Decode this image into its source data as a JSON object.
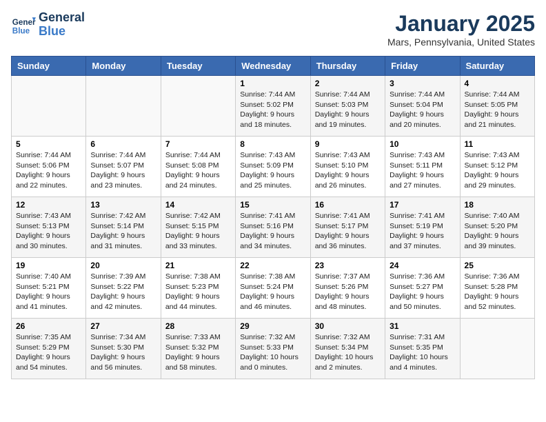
{
  "header": {
    "logo_line1": "General",
    "logo_line2": "Blue",
    "title": "January 2025",
    "subtitle": "Mars, Pennsylvania, United States"
  },
  "weekdays": [
    "Sunday",
    "Monday",
    "Tuesday",
    "Wednesday",
    "Thursday",
    "Friday",
    "Saturday"
  ],
  "weeks": [
    [
      {
        "day": "",
        "sunrise": "",
        "sunset": "",
        "daylight": ""
      },
      {
        "day": "",
        "sunrise": "",
        "sunset": "",
        "daylight": ""
      },
      {
        "day": "",
        "sunrise": "",
        "sunset": "",
        "daylight": ""
      },
      {
        "day": "1",
        "sunrise": "Sunrise: 7:44 AM",
        "sunset": "Sunset: 5:02 PM",
        "daylight": "Daylight: 9 hours and 18 minutes."
      },
      {
        "day": "2",
        "sunrise": "Sunrise: 7:44 AM",
        "sunset": "Sunset: 5:03 PM",
        "daylight": "Daylight: 9 hours and 19 minutes."
      },
      {
        "day": "3",
        "sunrise": "Sunrise: 7:44 AM",
        "sunset": "Sunset: 5:04 PM",
        "daylight": "Daylight: 9 hours and 20 minutes."
      },
      {
        "day": "4",
        "sunrise": "Sunrise: 7:44 AM",
        "sunset": "Sunset: 5:05 PM",
        "daylight": "Daylight: 9 hours and 21 minutes."
      }
    ],
    [
      {
        "day": "5",
        "sunrise": "Sunrise: 7:44 AM",
        "sunset": "Sunset: 5:06 PM",
        "daylight": "Daylight: 9 hours and 22 minutes."
      },
      {
        "day": "6",
        "sunrise": "Sunrise: 7:44 AM",
        "sunset": "Sunset: 5:07 PM",
        "daylight": "Daylight: 9 hours and 23 minutes."
      },
      {
        "day": "7",
        "sunrise": "Sunrise: 7:44 AM",
        "sunset": "Sunset: 5:08 PM",
        "daylight": "Daylight: 9 hours and 24 minutes."
      },
      {
        "day": "8",
        "sunrise": "Sunrise: 7:43 AM",
        "sunset": "Sunset: 5:09 PM",
        "daylight": "Daylight: 9 hours and 25 minutes."
      },
      {
        "day": "9",
        "sunrise": "Sunrise: 7:43 AM",
        "sunset": "Sunset: 5:10 PM",
        "daylight": "Daylight: 9 hours and 26 minutes."
      },
      {
        "day": "10",
        "sunrise": "Sunrise: 7:43 AM",
        "sunset": "Sunset: 5:11 PM",
        "daylight": "Daylight: 9 hours and 27 minutes."
      },
      {
        "day": "11",
        "sunrise": "Sunrise: 7:43 AM",
        "sunset": "Sunset: 5:12 PM",
        "daylight": "Daylight: 9 hours and 29 minutes."
      }
    ],
    [
      {
        "day": "12",
        "sunrise": "Sunrise: 7:43 AM",
        "sunset": "Sunset: 5:13 PM",
        "daylight": "Daylight: 9 hours and 30 minutes."
      },
      {
        "day": "13",
        "sunrise": "Sunrise: 7:42 AM",
        "sunset": "Sunset: 5:14 PM",
        "daylight": "Daylight: 9 hours and 31 minutes."
      },
      {
        "day": "14",
        "sunrise": "Sunrise: 7:42 AM",
        "sunset": "Sunset: 5:15 PM",
        "daylight": "Daylight: 9 hours and 33 minutes."
      },
      {
        "day": "15",
        "sunrise": "Sunrise: 7:41 AM",
        "sunset": "Sunset: 5:16 PM",
        "daylight": "Daylight: 9 hours and 34 minutes."
      },
      {
        "day": "16",
        "sunrise": "Sunrise: 7:41 AM",
        "sunset": "Sunset: 5:17 PM",
        "daylight": "Daylight: 9 hours and 36 minutes."
      },
      {
        "day": "17",
        "sunrise": "Sunrise: 7:41 AM",
        "sunset": "Sunset: 5:19 PM",
        "daylight": "Daylight: 9 hours and 37 minutes."
      },
      {
        "day": "18",
        "sunrise": "Sunrise: 7:40 AM",
        "sunset": "Sunset: 5:20 PM",
        "daylight": "Daylight: 9 hours and 39 minutes."
      }
    ],
    [
      {
        "day": "19",
        "sunrise": "Sunrise: 7:40 AM",
        "sunset": "Sunset: 5:21 PM",
        "daylight": "Daylight: 9 hours and 41 minutes."
      },
      {
        "day": "20",
        "sunrise": "Sunrise: 7:39 AM",
        "sunset": "Sunset: 5:22 PM",
        "daylight": "Daylight: 9 hours and 42 minutes."
      },
      {
        "day": "21",
        "sunrise": "Sunrise: 7:38 AM",
        "sunset": "Sunset: 5:23 PM",
        "daylight": "Daylight: 9 hours and 44 minutes."
      },
      {
        "day": "22",
        "sunrise": "Sunrise: 7:38 AM",
        "sunset": "Sunset: 5:24 PM",
        "daylight": "Daylight: 9 hours and 46 minutes."
      },
      {
        "day": "23",
        "sunrise": "Sunrise: 7:37 AM",
        "sunset": "Sunset: 5:26 PM",
        "daylight": "Daylight: 9 hours and 48 minutes."
      },
      {
        "day": "24",
        "sunrise": "Sunrise: 7:36 AM",
        "sunset": "Sunset: 5:27 PM",
        "daylight": "Daylight: 9 hours and 50 minutes."
      },
      {
        "day": "25",
        "sunrise": "Sunrise: 7:36 AM",
        "sunset": "Sunset: 5:28 PM",
        "daylight": "Daylight: 9 hours and 52 minutes."
      }
    ],
    [
      {
        "day": "26",
        "sunrise": "Sunrise: 7:35 AM",
        "sunset": "Sunset: 5:29 PM",
        "daylight": "Daylight: 9 hours and 54 minutes."
      },
      {
        "day": "27",
        "sunrise": "Sunrise: 7:34 AM",
        "sunset": "Sunset: 5:30 PM",
        "daylight": "Daylight: 9 hours and 56 minutes."
      },
      {
        "day": "28",
        "sunrise": "Sunrise: 7:33 AM",
        "sunset": "Sunset: 5:32 PM",
        "daylight": "Daylight: 9 hours and 58 minutes."
      },
      {
        "day": "29",
        "sunrise": "Sunrise: 7:32 AM",
        "sunset": "Sunset: 5:33 PM",
        "daylight": "Daylight: 10 hours and 0 minutes."
      },
      {
        "day": "30",
        "sunrise": "Sunrise: 7:32 AM",
        "sunset": "Sunset: 5:34 PM",
        "daylight": "Daylight: 10 hours and 2 minutes."
      },
      {
        "day": "31",
        "sunrise": "Sunrise: 7:31 AM",
        "sunset": "Sunset: 5:35 PM",
        "daylight": "Daylight: 10 hours and 4 minutes."
      },
      {
        "day": "",
        "sunrise": "",
        "sunset": "",
        "daylight": ""
      }
    ]
  ]
}
